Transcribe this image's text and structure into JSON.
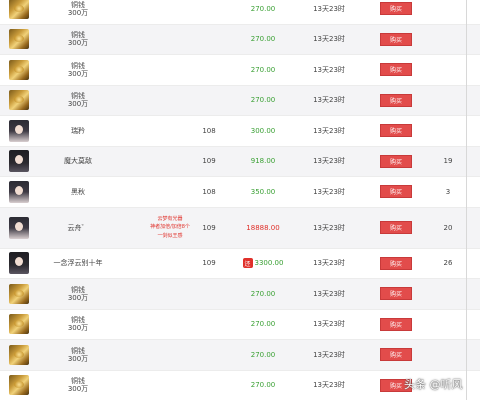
{
  "buy_label": "购买",
  "watermark": "头条 @听风",
  "colors": {
    "price_green": "#3aa034",
    "price_red": "#e0302a",
    "buy_button": "#e24c4b"
  },
  "rows": [
    {
      "icon": "gold-coins-icon",
      "name_line1": "铜钱",
      "name_line2": "300万",
      "price": "270.00",
      "time": "13天23时",
      "level": "",
      "count": "",
      "note_lines": [
        "",
        "",
        ""
      ]
    },
    {
      "icon": "gold-coins-icon",
      "name_line1": "铜钱",
      "name_line2": "300万",
      "price": "270.00",
      "time": "13天23时",
      "level": "",
      "count": "",
      "note_lines": [
        "",
        "",
        ""
      ]
    },
    {
      "icon": "gold-coins-icon",
      "name_line1": "铜钱",
      "name_line2": "300万",
      "price": "270.00",
      "time": "13天23时",
      "level": "",
      "count": "",
      "note_lines": [
        "",
        "",
        ""
      ]
    },
    {
      "icon": "gold-coins-icon",
      "name_line1": "铜钱",
      "name_line2": "300万",
      "price": "270.00",
      "time": "13天23时",
      "level": "",
      "count": "",
      "note_lines": [
        "",
        "",
        ""
      ]
    },
    {
      "icon": "character-avatar-icon",
      "name_line1": "瑞矜",
      "name_line2": "",
      "price": "300.00",
      "time": "13天23时",
      "level": "108",
      "count": "",
      "note_lines": [
        "",
        "",
        ""
      ]
    },
    {
      "icon": "character-avatar-icon",
      "name_line1": "魔大莫敌",
      "name_line2": "",
      "price": "918.00",
      "time": "13天23时",
      "level": "109",
      "count": "19",
      "note_lines": [
        "",
        "",
        ""
      ]
    },
    {
      "icon": "character-avatar-icon",
      "name_line1": "黑秋",
      "name_line2": "",
      "price": "350.00",
      "time": "13天23时",
      "level": "108",
      "count": "3",
      "note_lines": [
        "",
        "",
        ""
      ]
    },
    {
      "icon": "character-avatar-icon",
      "name_line1": "云舟゛",
      "name_line2": "",
      "price": "18888.00",
      "time": "13天23时",
      "level": "109",
      "count": "20",
      "note_lines": [
        "云梦有光器",
        "神者加倍/加倍8个",
        "一剑似王感"
      ]
    },
    {
      "icon": "character-avatar-icon",
      "name_line1": "一念浮云别十年",
      "name_line2": "",
      "price": "3300.00",
      "time": "13天23时",
      "level": "109",
      "count": "26",
      "tag": "还",
      "note_lines": [
        "",
        "",
        ""
      ]
    },
    {
      "icon": "gold-coins-icon",
      "name_line1": "铜钱",
      "name_line2": "300万",
      "price": "270.00",
      "time": "13天23时",
      "level": "",
      "count": "",
      "note_lines": [
        "",
        "",
        ""
      ]
    },
    {
      "icon": "gold-coins-icon",
      "name_line1": "铜钱",
      "name_line2": "300万",
      "price": "270.00",
      "time": "13天23时",
      "level": "",
      "count": "",
      "note_lines": [
        "",
        "",
        ""
      ]
    },
    {
      "icon": "gold-coins-icon",
      "name_line1": "铜钱",
      "name_line2": "300万",
      "price": "270.00",
      "time": "13天23时",
      "level": "",
      "count": "",
      "note_lines": [
        "",
        "",
        ""
      ]
    },
    {
      "icon": "gold-coins-icon",
      "name_line1": "铜钱",
      "name_line2": "300万",
      "price": "270.00",
      "time": "13天23时",
      "level": "",
      "count": "",
      "note_lines": [
        "",
        "",
        ""
      ]
    }
  ]
}
